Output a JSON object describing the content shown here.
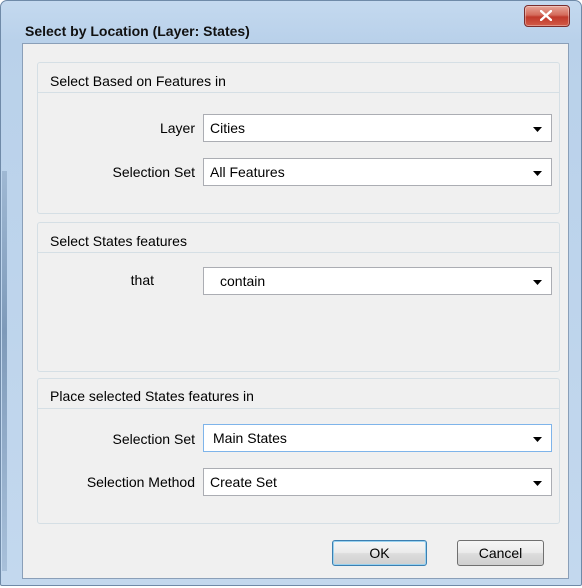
{
  "window": {
    "title": "Select by Location (Layer: States)",
    "close_glyph": "×"
  },
  "group_based_on": {
    "title": "Select Based on Features in",
    "layer_label": "Layer",
    "layer_value": "Cities",
    "selection_set_label": "Selection Set",
    "selection_set_value": "All Features"
  },
  "group_select": {
    "title": "Select States features",
    "that_label": "that",
    "relation_value": "contain"
  },
  "group_place": {
    "title": "Place selected States features in",
    "selection_set_label": "Selection Set",
    "selection_set_value": "Main States",
    "selection_method_label": "Selection Method",
    "selection_method_value": "Create Set"
  },
  "buttons": {
    "ok": "OK",
    "cancel": "Cancel"
  },
  "icons": {
    "close": "close-icon",
    "dropdown": "chevron-down-icon"
  },
  "colors": {
    "frame": "#b9d1ea",
    "close_button": "#c0392b",
    "focus_border": "#7eb4ea"
  }
}
